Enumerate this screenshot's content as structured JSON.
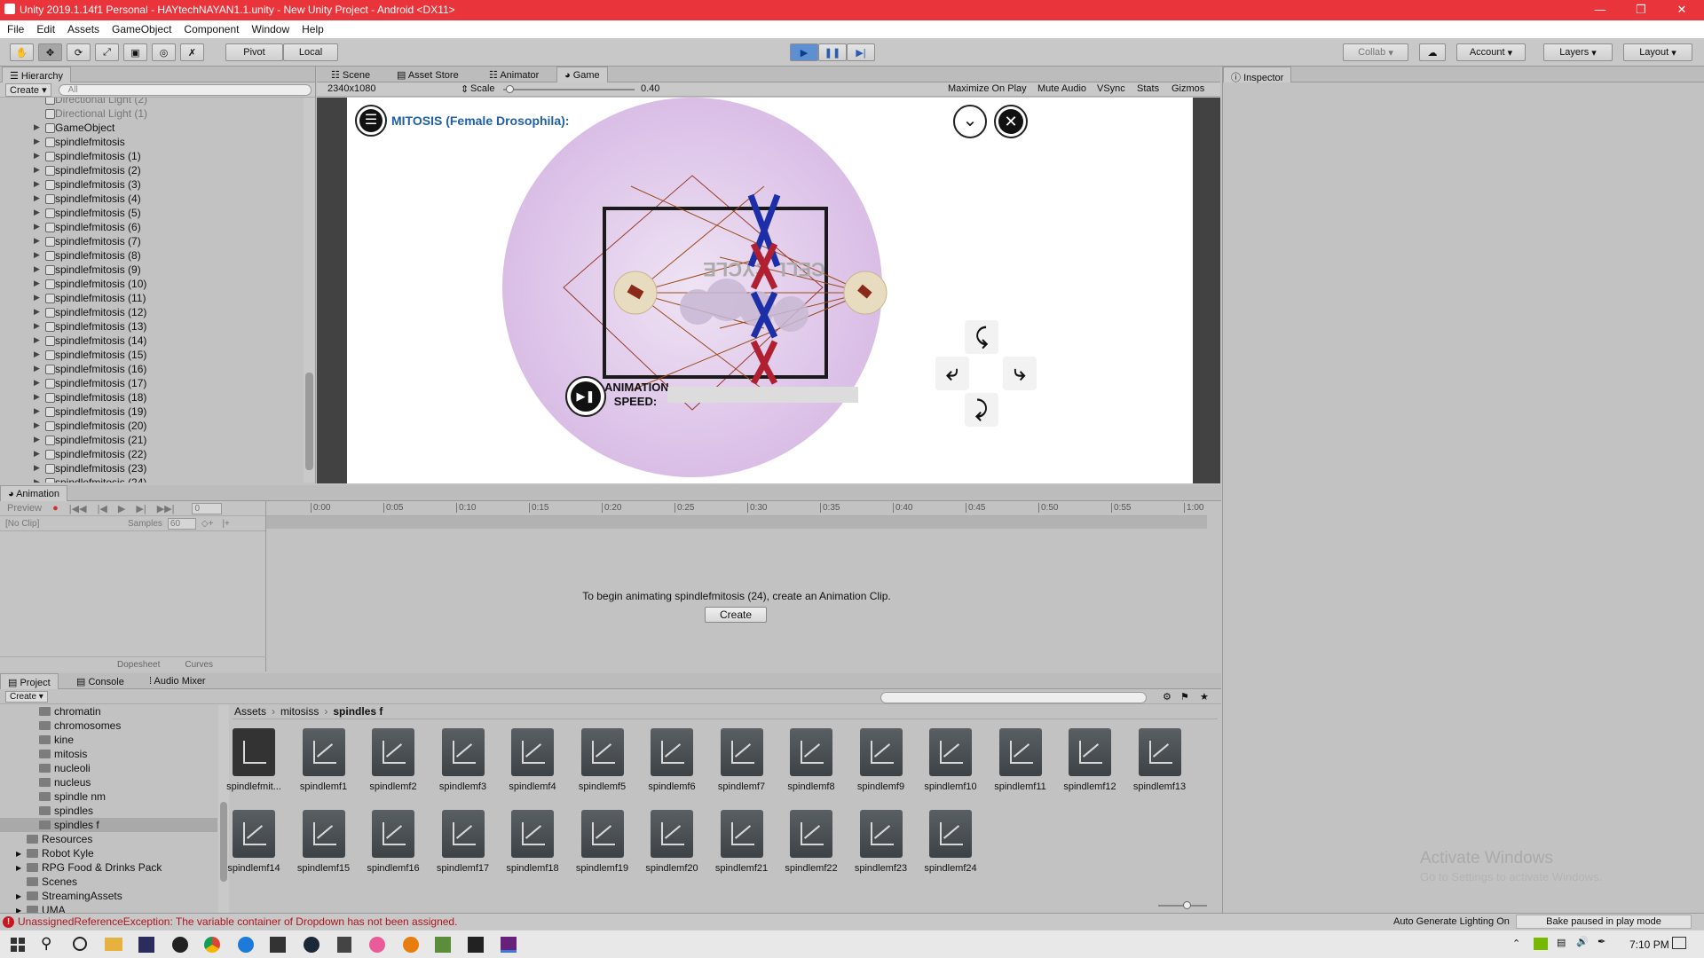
{
  "window": {
    "title": "Unity 2019.1.14f1 Personal - HAYtechNAYAN1.1.unity - New Unity Project - Android <DX11>"
  },
  "menu": [
    "File",
    "Edit",
    "Assets",
    "GameObject",
    "Component",
    "Window",
    "Help"
  ],
  "toolbar": {
    "pivot": "Pivot",
    "local": "Local",
    "collab": "Collab",
    "account": "Account",
    "layers": "Layers",
    "layout": "Layout"
  },
  "hierarchy": {
    "tab": "Hierarchy",
    "create": "Create",
    "search_placeholder": "All",
    "items": [
      "Directional Light (2)",
      "Directional Light (1)",
      "GameObject",
      "spindlefmitosis",
      "spindlefmitosis (1)",
      "spindlefmitosis (2)",
      "spindlefmitosis (3)",
      "spindlefmitosis (4)",
      "spindlefmitosis (5)",
      "spindlefmitosis (6)",
      "spindlefmitosis (7)",
      "spindlefmitosis (8)",
      "spindlefmitosis (9)",
      "spindlefmitosis (10)",
      "spindlefmitosis (11)",
      "spindlefmitosis (12)",
      "spindlefmitosis (13)",
      "spindlefmitosis (14)",
      "spindlefmitosis (15)",
      "spindlefmitosis (16)",
      "spindlefmitosis (17)",
      "spindlefmitosis (18)",
      "spindlefmitosis (19)",
      "spindlefmitosis (20)",
      "spindlefmitosis (21)",
      "spindlefmitosis (22)",
      "spindlefmitosis (23)",
      "spindlefmitosis (24)"
    ]
  },
  "game": {
    "tabs": [
      "Scene",
      "Asset Store",
      "Animator",
      "Game"
    ],
    "resolution": "2340x1080",
    "scale_label": "Scale",
    "scale_value": "0.40",
    "scale_level": 0.05,
    "options": [
      "Maximize On Play",
      "Mute Audio",
      "VSync",
      "Stats",
      "Gizmos"
    ],
    "heading": "MITOSIS (Female Drosophila):",
    "cell_text": "CELL CYCLE",
    "anim_label_1": "ANIMATION",
    "anim_label_2": "SPEED:",
    "colors": {
      "heading": "#1f5fa8",
      "bubble": "#e5d3ee"
    }
  },
  "inspector": {
    "tab": "Inspector"
  },
  "animation": {
    "tab": "Animation",
    "preview": "Preview",
    "clip": "[No Clip]",
    "samples_label": "Samples",
    "samples": "60",
    "frame": "0",
    "ticks": [
      "0:00",
      "0:05",
      "0:10",
      "0:15",
      "0:20",
      "0:25",
      "0:30",
      "0:35",
      "0:40",
      "0:45",
      "0:50",
      "0:55",
      "1:00"
    ],
    "message": "To begin animating spindlefmitosis (24), create an Animation Clip.",
    "create": "Create",
    "dopesheet": "Dopesheet",
    "curves": "Curves"
  },
  "project": {
    "tabs": [
      "Project",
      "Console",
      "Audio Mixer"
    ],
    "create": "Create",
    "tree_sub": [
      "chromatin",
      "chromosomes",
      "kine",
      "mitosis",
      "nucleoli",
      "nucleus",
      "spindle nm",
      "spindles",
      "spindles f"
    ],
    "tree_top": [
      "Resources",
      "Robot Kyle",
      "RPG Food & Drinks Pack",
      "Scenes",
      "StreamingAssets",
      "UMA"
    ],
    "breadcrumb": [
      "Assets",
      "mitosiss",
      "spindles f"
    ],
    "assets": [
      "spindlefmit...",
      "spindlemf1",
      "spindlemf2",
      "spindlemf3",
      "spindlemf4",
      "spindlemf5",
      "spindlemf6",
      "spindlemf7",
      "spindlemf8",
      "spindlemf9",
      "spindlemf10",
      "spindlemf11",
      "spindlemf12",
      "spindlemf13",
      "spindlemf14",
      "spindlemf15",
      "spindlemf16",
      "spindlemf17",
      "spindlemf18",
      "spindlemf19",
      "spindlemf20",
      "spindlemf21",
      "spindlemf22",
      "spindlemf23",
      "spindlemf24"
    ]
  },
  "watermark": {
    "line1": "Activate Windows",
    "line2": "Go to Settings to activate Windows."
  },
  "status": {
    "error": "UnassignedReferenceException: The variable container of Dropdown has not been assigned.",
    "lighting": "Auto Generate Lighting On",
    "bake": "Bake paused in play mode"
  },
  "taskbar": {
    "time": "7:10 PM",
    "icons": [
      "windows-start",
      "search",
      "task-view",
      "file-explorer",
      "premiere",
      "unknown",
      "chrome",
      "edge",
      "media",
      "steam",
      "calculator",
      "osu",
      "blender",
      "minecraft",
      "unity",
      "visual-studio"
    ]
  }
}
